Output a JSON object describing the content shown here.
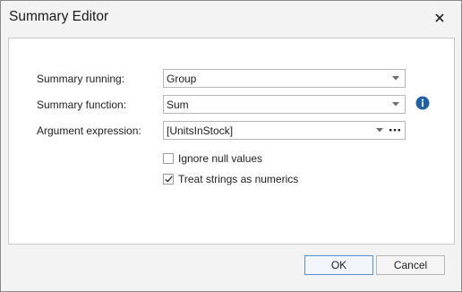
{
  "window": {
    "title": "Summary Editor"
  },
  "form": {
    "summary_running": {
      "label": "Summary running:",
      "value": "Group"
    },
    "summary_function": {
      "label": "Summary function:",
      "value": "Sum"
    },
    "argument_expression": {
      "label": "Argument expression:",
      "value": "[UnitsInStock]"
    },
    "ignore_null_values": {
      "label": "Ignore null values",
      "checked": false
    },
    "treat_strings_as_numerics": {
      "label": "Treat strings as numerics",
      "checked": true
    }
  },
  "buttons": {
    "ok": "OK",
    "cancel": "Cancel"
  },
  "icons": {
    "close": "close-icon",
    "dropdown": "chevron-down-icon",
    "ellipsis": "ellipsis-icon",
    "info": "info-icon",
    "check": "checkmark-icon"
  },
  "colors": {
    "info_icon": "#1f5fa8",
    "ok_border": "#5a8fd0"
  }
}
